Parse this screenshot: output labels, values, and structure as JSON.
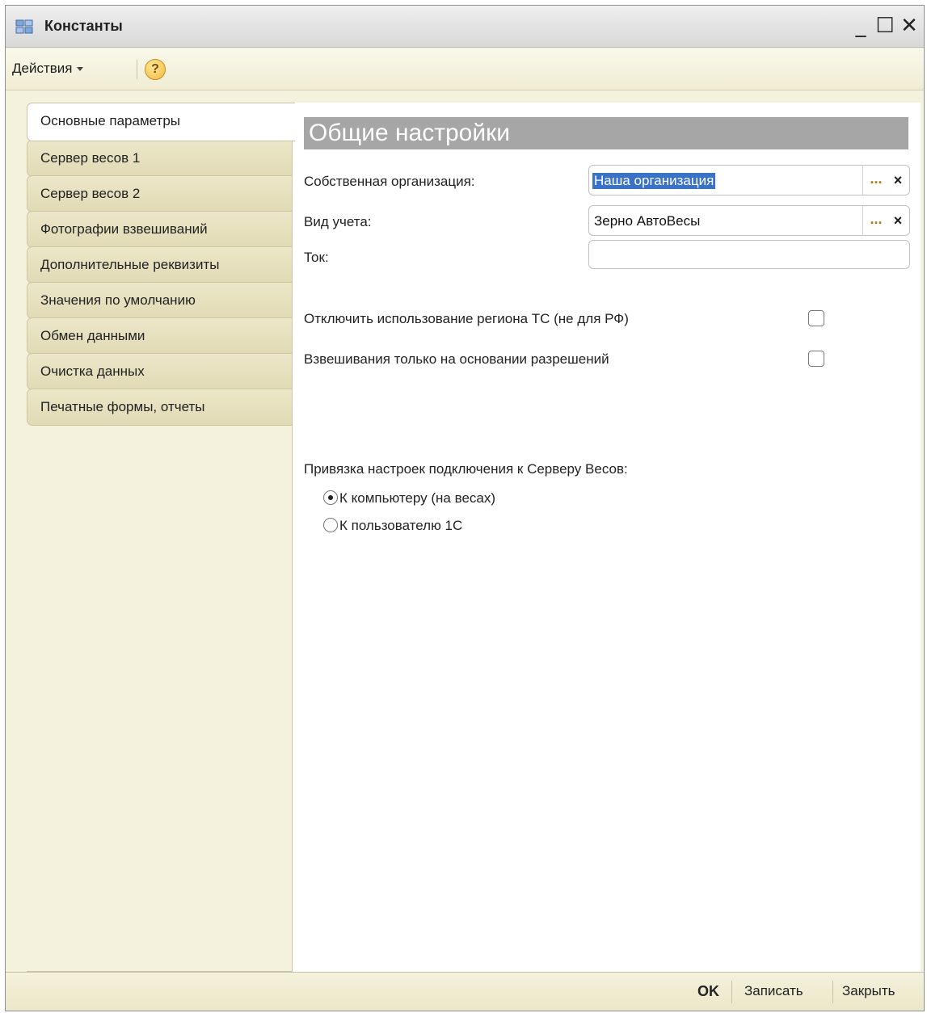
{
  "window": {
    "title": "Константы",
    "controls": {
      "minimize": "_",
      "maximize": "☐",
      "close": "✕"
    }
  },
  "toolbar": {
    "actions_label": "Действия",
    "help_glyph": "?"
  },
  "tabs": [
    {
      "label": "Основные параметры",
      "active": true
    },
    {
      "label": "Сервер весов 1"
    },
    {
      "label": "Сервер весов 2"
    },
    {
      "label": "Фотографии взвешиваний"
    },
    {
      "label": "Дополнительные реквизиты"
    },
    {
      "label": "Значения по умолчанию"
    },
    {
      "label": "Обмен данными"
    },
    {
      "label": "Очистка данных"
    },
    {
      "label": "Печатные формы, отчеты"
    }
  ],
  "panel": {
    "header": "Общие настройки",
    "fields": {
      "organization": {
        "label": "Собственная организация:",
        "value": "Наша организация"
      },
      "account_type": {
        "label": "Вид учета:",
        "value": "Зерно АвтоВесы"
      },
      "tok": {
        "label": "Ток:",
        "value": ""
      }
    },
    "field_buttons": {
      "select": "...",
      "clear": "×"
    },
    "checkboxes": {
      "disable_region": {
        "label": "Отключить использование региона ТС (не для РФ)",
        "checked": false
      },
      "permits_only": {
        "label": "Взвешивания только на основании разрешений",
        "checked": false
      }
    },
    "binding": {
      "label": "Привязка настроек подключения к Серверу Весов:",
      "options": [
        {
          "label": "К компьютеру (на весах)",
          "selected": true
        },
        {
          "label": "К пользователю 1С",
          "selected": false
        }
      ]
    }
  },
  "footer": {
    "ok": "OK",
    "save": "Записать",
    "close": "Закрыть"
  }
}
